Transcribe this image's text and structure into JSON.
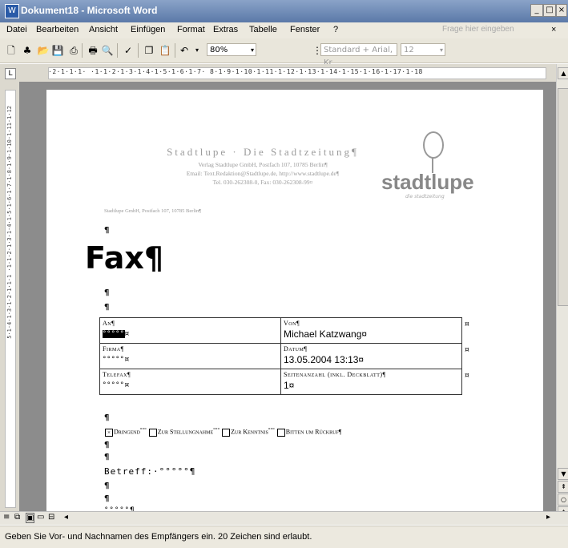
{
  "window": {
    "title": "Dokument18 - Microsoft Word"
  },
  "menu": {
    "items": [
      "Datei",
      "Bearbeiten",
      "Ansicht",
      "Einfügen",
      "Format",
      "Extras",
      "Tabelle",
      "Fenster",
      "?"
    ],
    "help_placeholder": "Frage hier eingeben",
    "close_glyph": "×"
  },
  "toolbar": {
    "zoom": "80%",
    "style": "Standard + Arial, Kr",
    "font_size": "12"
  },
  "ruler": {
    "h_ticks": "·2·1·1·1·  ·1·1·2·1·3·1·4·1·5·1·6·1·7·  8·1·9·1·10·1·11·1·12·1·13·1·14·1·15·1·16·1·17·1·18",
    "v_ticks": "5·1·4·1·3·1·2·1·1·1 ·1·1·2·1·3·1·4·1·5·1·6·1·7·1·8·1·9·1·10·1·11·1·12"
  },
  "document": {
    "letterhead": {
      "name": "Stadtlupe · Die Stadtzeitung¶",
      "line1": "Verlag Stadtlupe GmbH, Postfach 107, 10785 Berlin¶",
      "line2": "Email: Text.Redaktion@Stadtlupe.de, http://www.stadtlupe.de¶",
      "line3": "Tel. 030-262308-0, Fax: 030-262308-99¤"
    },
    "logo": {
      "text": "stadtlupe",
      "tagline": "die stadtzeitung"
    },
    "sender_line": "Stadtlupe GmbH, Postfach 107, 10785 Berlin¶",
    "pilcrow": "¶",
    "fax_title": "Fax¶",
    "form": {
      "an_label": "An¶",
      "an_value": "°°°°°",
      "von_label": "Von¶",
      "von_value": "Michael Katzwang¤",
      "firma_label": "Firma¶",
      "firma_value": "°°°°°¤",
      "datum_label": "Datum¶",
      "datum_value": "13.05.2004 13:13¤",
      "telefax_label": "Telefax¶",
      "telefax_value": "°°°°°¤",
      "seiten_label": "Seitenanzahl (inkl. Deckblatt)¶",
      "seiten_value": "1¤",
      "cell_end": "¤"
    },
    "checkboxes": [
      {
        "label": "Dringend",
        "checked": true
      },
      {
        "label": "Zur Stellungnahme",
        "checked": false
      },
      {
        "label": "Zur Kenntnis",
        "checked": false
      },
      {
        "label": "Bitten um Rückruf¶",
        "checked": false
      }
    ],
    "checkbox_separator": "°°°",
    "betreff": "Betreff:·°°°°°¶",
    "body_placeholder": "°°°°°¶"
  },
  "status": {
    "text": "Geben Sie Vor- und Nachnamen des Empfängers ein. 20 Zeichen sind erlaubt."
  }
}
